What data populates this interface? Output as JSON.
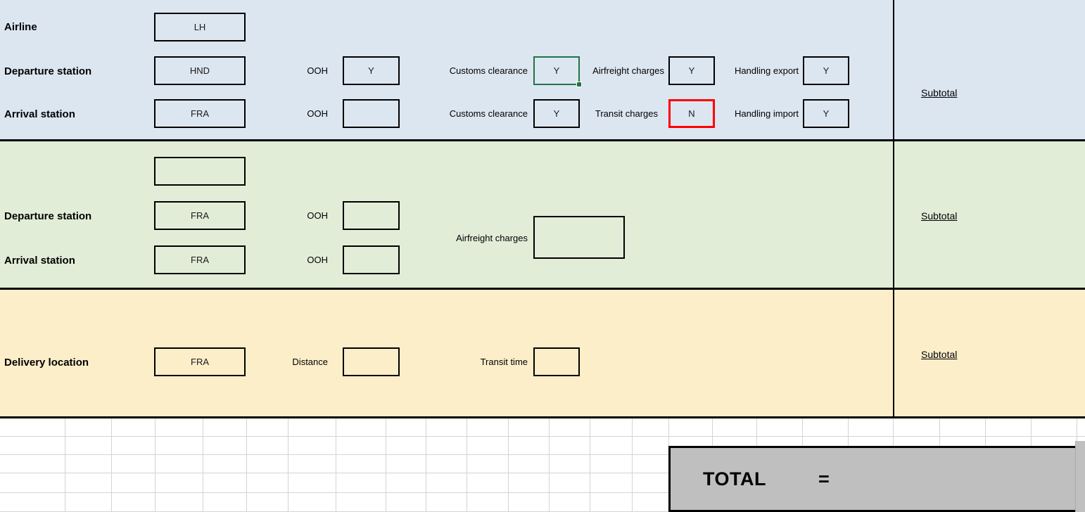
{
  "theme": {
    "band_blue": "#DCE6F1",
    "band_green": "#E2EDD8",
    "band_orange": "#FDEECA",
    "total_fill": "#BFBFBF",
    "selection_green": "#217346",
    "flag_red": "#FF0000",
    "border_black": "#000000",
    "gridline": "#D4D4D4"
  },
  "air_section": {
    "rows": [
      {
        "label": "Airline",
        "value": "LH"
      },
      {
        "label": "Departure station",
        "value": "HND",
        "ooh_label": "OOH",
        "ooh_value": "Y",
        "customs_label": "Customs clearance",
        "customs_value": "Y",
        "charges_label": "Airfreight charges",
        "charges_value": "Y",
        "handling_label": "Handling export",
        "handling_value": "Y"
      },
      {
        "label": "Arrival station",
        "value": "FRA",
        "ooh_label": "OOH",
        "ooh_value": "",
        "customs_label": "Customs clearance",
        "customs_value": "Y",
        "charges_label": "Transit charges",
        "charges_value": "N",
        "handling_label": "Handling import",
        "handling_value": "Y"
      }
    ],
    "subtotal_label": "Subtotal"
  },
  "road_section": {
    "rows": [
      {
        "label": "",
        "value": ""
      },
      {
        "label": "Departure station",
        "value": "FRA",
        "ooh_label": "OOH",
        "ooh_value": ""
      },
      {
        "label": "Arrival station",
        "value": "FRA",
        "ooh_label": "OOH",
        "ooh_value": ""
      }
    ],
    "charges_label": "Airfreight charges",
    "charges_value": "",
    "subtotal_label": "Subtotal"
  },
  "delivery_section": {
    "label": "Delivery location",
    "value": "FRA",
    "distance_label": "Distance",
    "distance_value": "",
    "transit_time_label": "Transit time",
    "transit_time_value": "",
    "subtotal_label": "Subtotal"
  },
  "total": {
    "label": "TOTAL",
    "equals": "=",
    "value": ""
  }
}
